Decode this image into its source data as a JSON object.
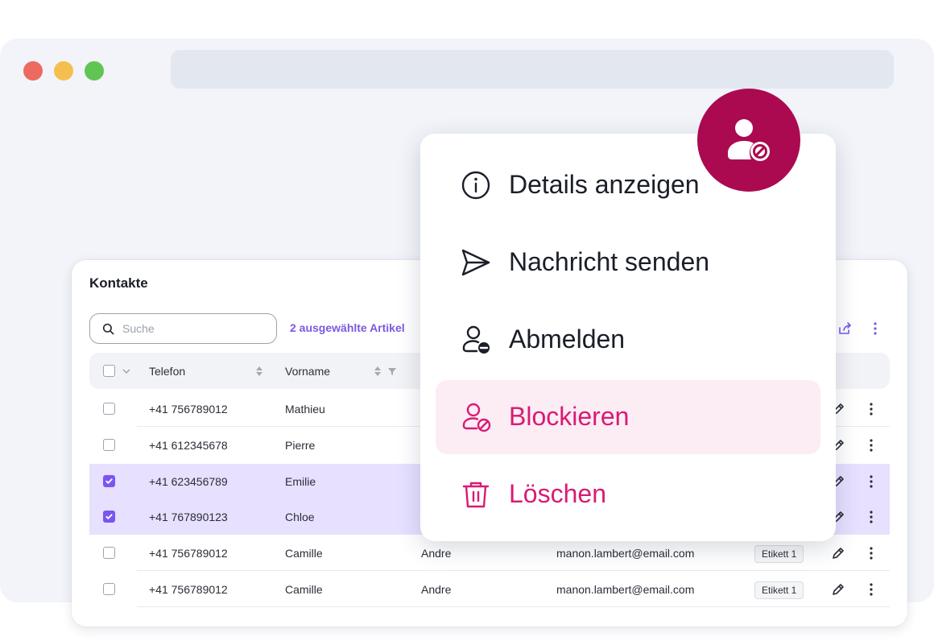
{
  "card": {
    "title": "Kontakte",
    "search_placeholder": "Suche",
    "selected_info": "2 ausgewählte Artikel"
  },
  "table": {
    "columns": [
      "Telefon",
      "Vorname"
    ],
    "rows": [
      {
        "checked": false,
        "telefon": "+41 756789012",
        "vorname": "Mathieu",
        "nachname": "",
        "email": "",
        "tag": ""
      },
      {
        "checked": false,
        "telefon": "+41 612345678",
        "vorname": "Pierre",
        "nachname": "",
        "email": "",
        "tag": ""
      },
      {
        "checked": true,
        "telefon": "+41 623456789",
        "vorname": "Emilie",
        "nachname": "",
        "email": "",
        "tag": ""
      },
      {
        "checked": true,
        "telefon": "+41 767890123",
        "vorname": "Chloe",
        "nachname": "",
        "email": "",
        "tag": ""
      },
      {
        "checked": false,
        "telefon": "+41 756789012",
        "vorname": "Camille",
        "nachname": "Andre",
        "email": "manon.lambert@email.com",
        "tag": "Etikett 1"
      },
      {
        "checked": false,
        "telefon": "+41 756789012",
        "vorname": "Camille",
        "nachname": "Andre",
        "email": "manon.lambert@email.com",
        "tag": "Etikett 1"
      }
    ]
  },
  "menu": {
    "items": [
      {
        "label": "Details anzeigen",
        "icon": "info-icon"
      },
      {
        "label": "Nachricht senden",
        "icon": "send-icon"
      },
      {
        "label": "Abmelden",
        "icon": "user-remove-icon"
      },
      {
        "label": "Blockieren",
        "icon": "user-block-icon"
      },
      {
        "label": "Löschen",
        "icon": "trash-icon"
      }
    ]
  },
  "colors": {
    "accent": "#7b55f0",
    "danger": "#d81b74",
    "badge": "#ab0a50",
    "selected_row": "#e7e0ff"
  }
}
